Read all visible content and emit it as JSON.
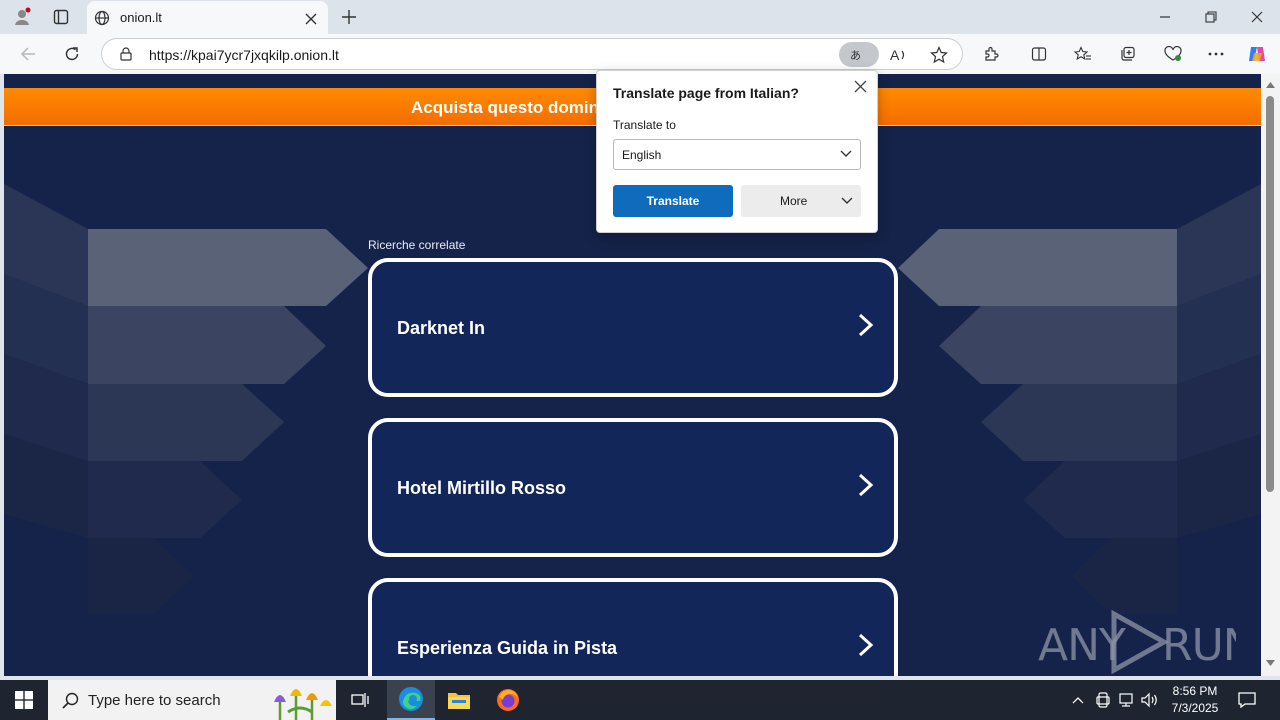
{
  "browser": {
    "tab_title": "onion.lt",
    "url": "https://kpai7ycr7jxqkilp.onion.lt"
  },
  "page": {
    "banner_text": "Acquista questo dominio",
    "related_label": "Ricerche correlate",
    "cards": [
      {
        "label": "Darknet In"
      },
      {
        "label": "Hotel Mirtillo Rosso"
      },
      {
        "label": "Esperienza Guida in Pista"
      }
    ]
  },
  "translate_popup": {
    "title": "Translate page from Italian?",
    "translate_to_label": "Translate to",
    "language_value": "English",
    "translate_button": "Translate",
    "more_button": "More"
  },
  "taskbar": {
    "search_placeholder": "Type here to search",
    "time": "8:56 PM",
    "date": "7/3/2025"
  },
  "watermark": "ANY RUN",
  "colors": {
    "banner_orange": "#f57a00",
    "page_bg": "#15234a",
    "translate_blue": "#0f6cbd"
  }
}
